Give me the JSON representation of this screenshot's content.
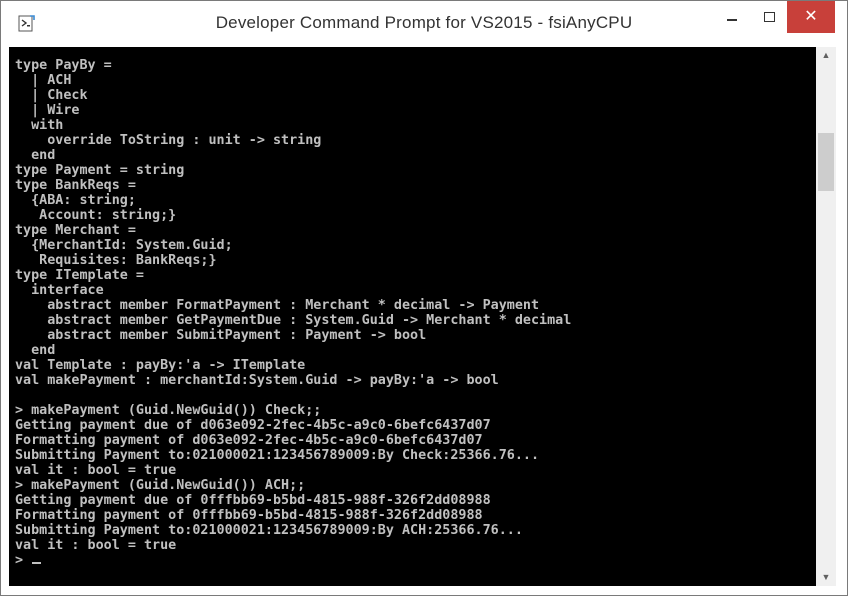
{
  "window": {
    "title": "Developer Command Prompt for VS2015 - fsiAnyCPU",
    "icon": "console-app-icon",
    "controls": {
      "minimize": "minimize-icon",
      "maximize": "maximize-icon",
      "close": "✕"
    }
  },
  "console": {
    "lines": [
      "type PayBy =",
      "  | ACH",
      "  | Check",
      "  | Wire",
      "  with",
      "    override ToString : unit -> string",
      "  end",
      "type Payment = string",
      "type BankReqs =",
      "  {ABA: string;",
      "   Account: string;}",
      "type Merchant =",
      "  {MerchantId: System.Guid;",
      "   Requisites: BankReqs;}",
      "type ITemplate =",
      "  interface",
      "    abstract member FormatPayment : Merchant * decimal -> Payment",
      "    abstract member GetPaymentDue : System.Guid -> Merchant * decimal",
      "    abstract member SubmitPayment : Payment -> bool",
      "  end",
      "val Template : payBy:'a -> ITemplate",
      "val makePayment : merchantId:System.Guid -> payBy:'a -> bool",
      "",
      "> makePayment (Guid.NewGuid()) Check;;",
      "Getting payment due of d063e092-2fec-4b5c-a9c0-6befc6437d07",
      "Formatting payment of d063e092-2fec-4b5c-a9c0-6befc6437d07",
      "Submitting Payment to:021000021:123456789009:By Check:25366.76...",
      "val it : bool = true",
      "> makePayment (Guid.NewGuid()) ACH;;",
      "Getting payment due of 0fffbb69-b5bd-4815-988f-326f2dd08988",
      "Formatting payment of 0fffbb69-b5bd-4815-988f-326f2dd08988",
      "Submitting Payment to:021000021:123456789009:By ACH:25366.76...",
      "val it : bool = true"
    ],
    "prompt": "> ",
    "colors": {
      "background": "#000000",
      "text": "#c0c0c0"
    }
  },
  "scrollbar": {
    "up_arrow": "▲",
    "down_arrow": "▼"
  }
}
